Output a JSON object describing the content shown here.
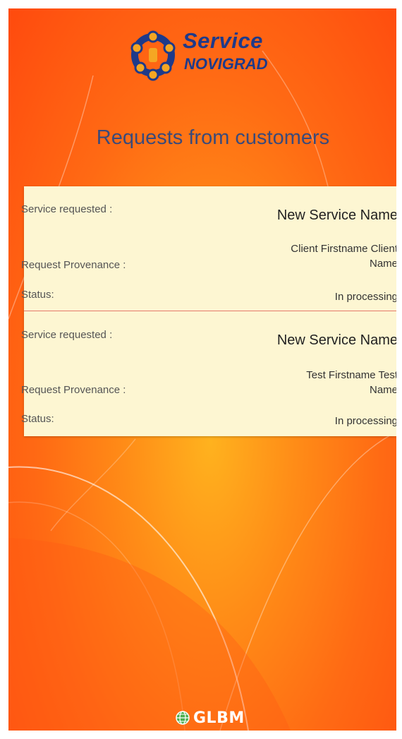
{
  "app": {
    "logo_line1": "Service",
    "logo_line2": "NOVIGRAD",
    "brand_color": "#1e3a8a"
  },
  "page": {
    "title": "Requests from customers"
  },
  "requests": [
    {
      "service_label": "Service requested :",
      "service_value": "New Service Name",
      "provenance_label": "Request Provenance :",
      "provenance_line1": "Client Firstname Client",
      "provenance_line2": "Name",
      "status_label": "Status:",
      "status_value": "In processing"
    },
    {
      "service_label": "Service requested :",
      "service_value": "New Service Name",
      "provenance_label": "Request Provenance :",
      "provenance_line1": "Test Firstname Test",
      "provenance_line2": "Name",
      "status_label": "Status:",
      "status_value": "In processing"
    }
  ],
  "footer": {
    "brand": "GLBM",
    "icon": "globe-icon"
  },
  "colors": {
    "background_center": "#ffb21e",
    "background_edge": "#ff4a0e",
    "card_background": "#fdf6d2",
    "divider": "#e57a6c",
    "title_color": "#3b4a7a"
  }
}
